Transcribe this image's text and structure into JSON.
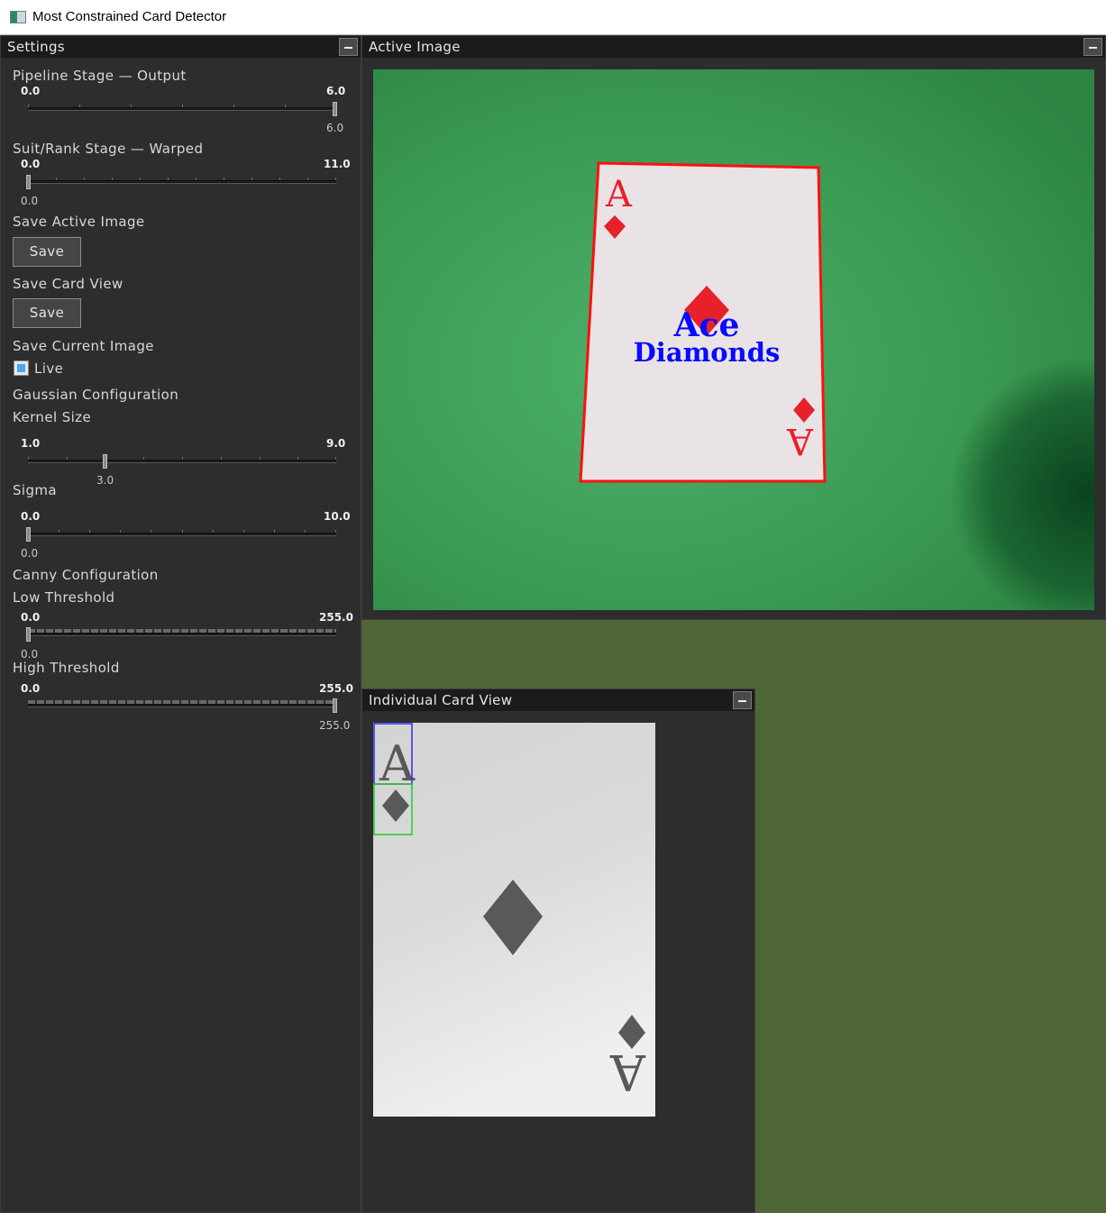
{
  "window": {
    "title": "Most Constrained Card Detector"
  },
  "settings": {
    "title": "Settings",
    "pipeline_stage": {
      "label": "Pipeline Stage — Output",
      "min": "0.0",
      "max": "6.0",
      "value": "6.0"
    },
    "suit_rank_stage": {
      "label": "Suit/Rank Stage — Warped",
      "min": "0.0",
      "max": "11.0",
      "value": "0.0"
    },
    "save_active": {
      "label": "Save Active Image",
      "button": "Save"
    },
    "save_card": {
      "label": "Save Card View",
      "button": "Save"
    },
    "save_current": {
      "label": "Save Current Image",
      "checkbox_label": "Live",
      "checked": true
    },
    "gaussian": {
      "label": "Gaussian Configuration",
      "kernel": {
        "label": "Kernel Size",
        "min": "1.0",
        "max": "9.0",
        "value": "3.0"
      },
      "sigma": {
        "label": "Sigma",
        "min": "0.0",
        "max": "10.0",
        "value": "0.0"
      }
    },
    "canny": {
      "label": "Canny Configuration",
      "low": {
        "label": "Low Threshold",
        "min": "0.0",
        "max": "255.0",
        "value": "0.0"
      },
      "high": {
        "label": "High Threshold",
        "min": "0.0",
        "max": "255.0",
        "value": "255.0"
      }
    }
  },
  "active_image": {
    "title": "Active Image",
    "card_rank": "A",
    "detected_rank": "Ace",
    "detected_suit": "Diamonds",
    "colors": {
      "table": "#3a9a52",
      "outline": "#ff1010",
      "label": "#0a0aff",
      "suit": "#e8202a"
    }
  },
  "card_view": {
    "title": "Individual Card View",
    "card_rank": "A",
    "colors": {
      "rank_box": "#2a2aff",
      "suit_box": "#22cc22",
      "ink": "#595959"
    }
  }
}
